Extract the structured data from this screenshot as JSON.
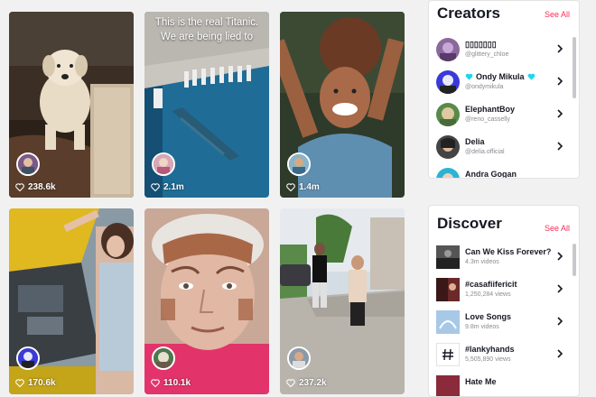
{
  "videos": [
    {
      "likes": "238.6k",
      "caption": ""
    },
    {
      "likes": "2.1m",
      "caption_line1": "This is the real Titanic.",
      "caption_line2": "We are being lied to"
    },
    {
      "likes": "1.4m"
    },
    {
      "likes": "170.6k"
    },
    {
      "likes": "110.1k"
    },
    {
      "likes": "237.2k"
    }
  ],
  "creators": {
    "title": "Creators",
    "see_all": "See All",
    "items": [
      {
        "name": "▯▯▯▯▯▯▯",
        "handle": "@glittery_chloe"
      },
      {
        "name": "Ondy Mikula",
        "handle": "@ondymikula"
      },
      {
        "name": "ElephantBoy",
        "handle": "@reno_casselly"
      },
      {
        "name": "Delia",
        "handle": "@delia.official"
      },
      {
        "name": "Andra Gogan",
        "handle": ""
      }
    ]
  },
  "discover": {
    "title": "Discover",
    "see_all": "See All",
    "items": [
      {
        "name": "Can We Kiss Forever?",
        "meta": "4.3m videos",
        "icon": "music-thumb"
      },
      {
        "name": "#casafiifericit",
        "meta": "1,250,284 views",
        "icon": "video-thumb"
      },
      {
        "name": "Love Songs",
        "meta": "9.8m videos",
        "icon": "music-thumb"
      },
      {
        "name": "#lankyhands",
        "meta": "5,505,890 views",
        "icon": "hashtag-icon"
      },
      {
        "name": "Hate Me",
        "meta": "",
        "icon": "music-thumb"
      }
    ]
  },
  "colors": {
    "accent": "#fe2c55",
    "verified": "#20d5ec"
  }
}
